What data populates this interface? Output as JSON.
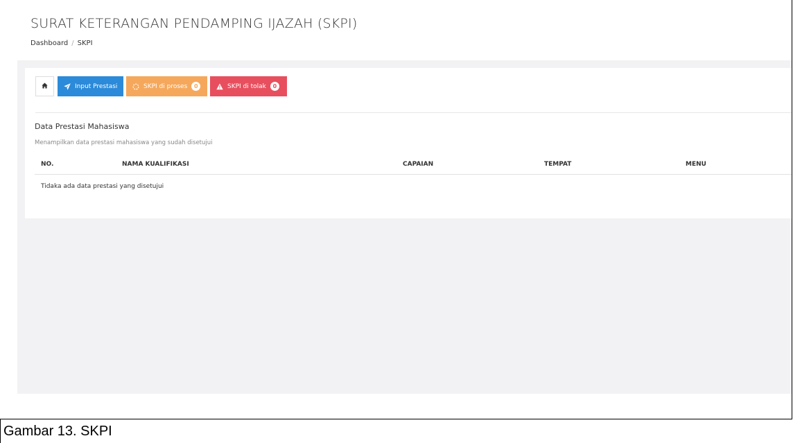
{
  "header": {
    "title": "SURAT KETERANGAN PENDAMPING IJAZAH (SKPI)",
    "breadcrumb": [
      "Dashboard",
      "SKPI"
    ]
  },
  "toolbar": {
    "home_icon": "home-icon",
    "input_prestasi": {
      "label": "Input Prestasi",
      "icon": "paper-plane-icon",
      "color": "#2b8ad9"
    },
    "skpi_proses": {
      "label": "SKPI di proses",
      "count": "0",
      "icon": "spinner-icon",
      "color": "#f5a85c"
    },
    "skpi_tolak": {
      "label": "SKPI di tolak",
      "count": "0",
      "icon": "warning-icon",
      "color": "#e84f5e"
    }
  },
  "section": {
    "title": "Data Prestasi Mahasiswa",
    "subtitle": "Menampilkan data prestasi mahasiswa yang sudah disetujui"
  },
  "table": {
    "columns": [
      "NO.",
      "NAMA KUALIFIKASI",
      "CAPAIAN",
      "TEMPAT",
      "MENU"
    ],
    "empty_message": "Tidaka ada data prestasi yang disetujui"
  },
  "caption": "Gambar 13. SKPI"
}
